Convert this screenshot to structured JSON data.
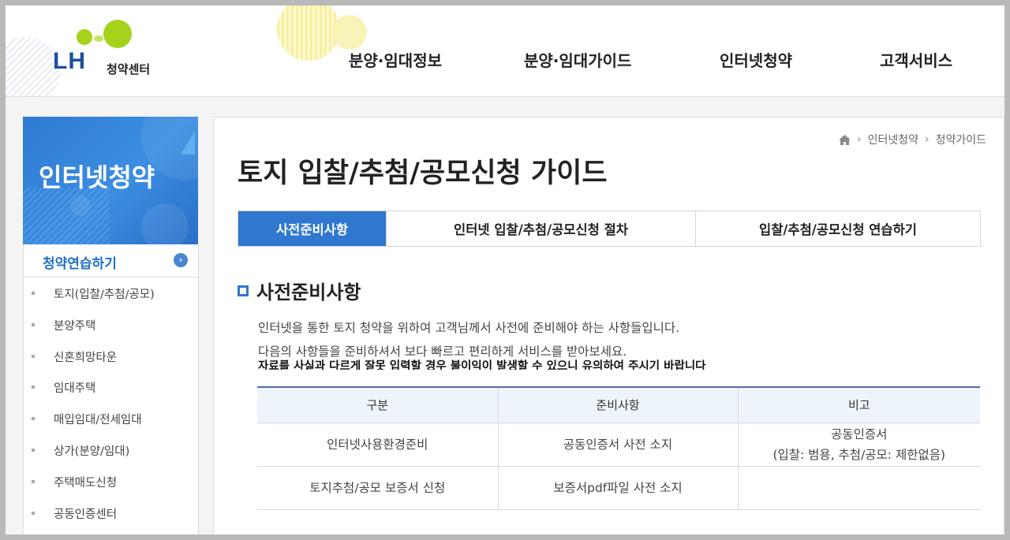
{
  "header": {
    "logo_text": "LH",
    "logo_sub": "청약센터",
    "nav": [
      "분양·임대정보",
      "분양·임대가이드",
      "인터넷청약",
      "고객서비스"
    ]
  },
  "sidebar": {
    "banner_title": "인터넷청약",
    "section_label": "청약연습하기",
    "items": [
      "토지(입찰/추첨/공모)",
      "분양주택",
      "신혼희망타운",
      "임대주택",
      "매입임대/전세임대",
      "상가(분양/임대)",
      "주택매도신청",
      "공동인증센터"
    ]
  },
  "breadcrumb": {
    "home_icon": "home-icon",
    "items": [
      "인터넷청약",
      "청약가이드"
    ]
  },
  "page": {
    "title": "토지 입찰/추첨/공모신청 가이드",
    "tabs": [
      "사전준비사항",
      "인터넷 입찰/추첨/공모신청 절차",
      "입찰/추첨/공모신청 연습하기"
    ],
    "active_tab": 0,
    "section_title": "사전준비사항",
    "desc1": "인터넷을 통한 토지 청약을 위하여 고객님께서 사전에 준비해야 하는 사항들입니다.",
    "desc2": "다음의 사항들을 준비하셔서 보다 빠르고 편리하게 서비스를 받아보세요.",
    "desc3": "자료를 사실과 다르게 잘못 입력할 경우 불이익이 발생할 수 있으니 유의하여 주시기 바랍니다"
  },
  "table": {
    "headers": [
      "구분",
      "준비사항",
      "비고"
    ],
    "rows": [
      {
        "category": "인터넷사용환경준비",
        "prep": "공동인증서 사전 소지",
        "note1": "공동인증서",
        "note2": "(입찰: 범용, 추첨/공모: 제한없음)"
      },
      {
        "category": "토지추첨/공모 보증서 신청",
        "prep": "보증서pdf파일 사전 소지",
        "note1": "",
        "note2": ""
      }
    ]
  },
  "colors": {
    "accent": "#2f77cf",
    "logo_blue": "#1d4f9c",
    "logo_green": "#a6d21c"
  }
}
